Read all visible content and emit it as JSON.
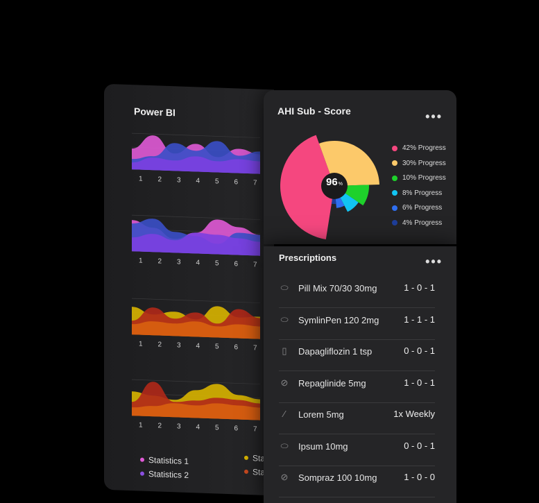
{
  "power_bi": {
    "title": "Power BI",
    "x_ticks": [
      "1",
      "2",
      "3",
      "4",
      "5",
      "6",
      "7"
    ],
    "legend": [
      {
        "label": "Statistics 1",
        "color": "#e05ad6"
      },
      {
        "label": "Statistics 2",
        "color": "#8a4fe0"
      },
      {
        "label": "Stat",
        "color": "#d8b400"
      },
      {
        "label": "Stat",
        "color": "#c84a20"
      }
    ],
    "colors": {
      "pink": "#e05ad6",
      "purple": "#7b3fe0",
      "blue": "#3a4fc8",
      "yellow": "#d8b400",
      "orange": "#d86010",
      "red": "#b02818"
    }
  },
  "ahi": {
    "title": "AHI Sub - Score",
    "menu_icon": "more-dots-icon",
    "center_value": "96",
    "center_unit": "%",
    "segments": [
      {
        "label": "42% Progress",
        "value": 42,
        "color": "#f5477f"
      },
      {
        "label": "30% Progress",
        "value": 30,
        "color": "#fcc96a"
      },
      {
        "label": "10% Progress",
        "value": 10,
        "color": "#1ed12b"
      },
      {
        "label": "8% Progress",
        "value": 8,
        "color": "#12c4f2"
      },
      {
        "label": "6% Progress",
        "value": 6,
        "color": "#2f6ff0"
      },
      {
        "label": "4% Progress",
        "value": 4,
        "color": "#1e3e9a"
      }
    ]
  },
  "prescriptions": {
    "title": "Prescriptions",
    "menu_icon": "more-dots-icon",
    "items": [
      {
        "name": "Pill Mix 70/30 30mg",
        "dose": "1 - 0 - 1",
        "icon": "pill-icon"
      },
      {
        "name": "SymlinPen 120 2mg",
        "dose": "1 - 1 - 1",
        "icon": "pill-icon"
      },
      {
        "name": "Dapagliflozin 1 tsp",
        "dose": "0 - 0 - 1",
        "icon": "bottle-icon"
      },
      {
        "name": "Repaglinide 5mg",
        "dose": "1 - 0 - 1",
        "icon": "tablet-icon"
      },
      {
        "name": "Lorem 5mg",
        "dose": "1x Weekly",
        "icon": "syringe-icon"
      },
      {
        "name": "Ipsum 10mg",
        "dose": "0 - 0 - 1",
        "icon": "pill-icon"
      },
      {
        "name": "Sompraz 100 10mg",
        "dose": "1 - 0 - 0",
        "icon": "tablet-icon"
      }
    ]
  }
}
